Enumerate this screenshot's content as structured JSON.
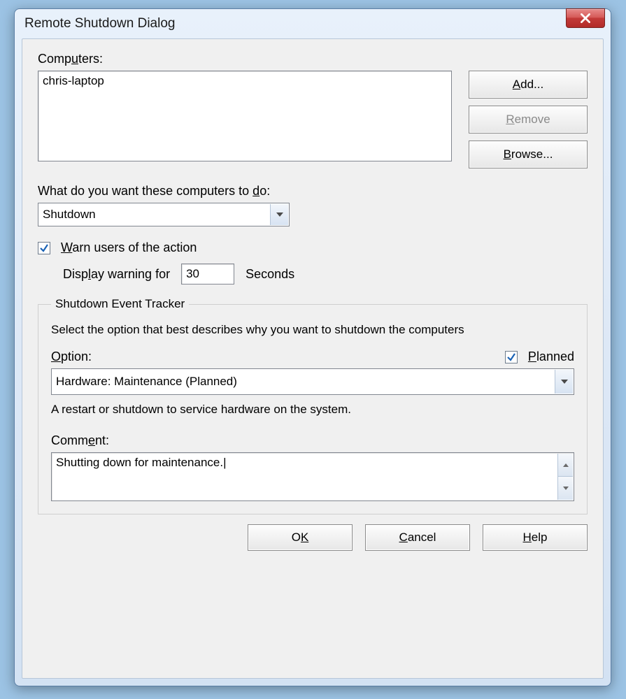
{
  "window": {
    "title": "Remote Shutdown Dialog"
  },
  "computers": {
    "label_pre": "Comp",
    "label_u": "u",
    "label_post": "ters:",
    "items": [
      "chris-laptop"
    ]
  },
  "sidebuttons": {
    "add_u": "A",
    "add_post": "dd...",
    "remove_u": "R",
    "remove_post": "emove",
    "browse_u": "B",
    "browse_post": "rowse..."
  },
  "action": {
    "label_pre": "What do you want these computers to ",
    "label_u": "d",
    "label_post": "o:",
    "selected": "Shutdown"
  },
  "warn": {
    "checked": true,
    "label_u": "W",
    "label_post": "arn users of the action",
    "display_pre": "Disp",
    "display_u": "l",
    "display_post": "ay warning for",
    "seconds_value": "30",
    "seconds_label": "Seconds"
  },
  "tracker": {
    "legend": "Shutdown Event Tracker",
    "description": "Select the option that best describes why you want to shutdown the computers",
    "option_label_u": "O",
    "option_label_post": "ption:",
    "planned_checked": true,
    "planned_u": "P",
    "planned_post": "lanned",
    "reason_selected": "Hardware: Maintenance (Planned)",
    "reason_description": "A restart or shutdown to service hardware on the system.",
    "comment_label_pre": "Comm",
    "comment_label_u": "e",
    "comment_label_post": "nt:",
    "comment_value": "Shutting down for maintenance."
  },
  "footer": {
    "ok_pre": "O",
    "ok_u": "K",
    "cancel_u": "C",
    "cancel_post": "ancel",
    "help_u": "H",
    "help_post": "elp"
  }
}
